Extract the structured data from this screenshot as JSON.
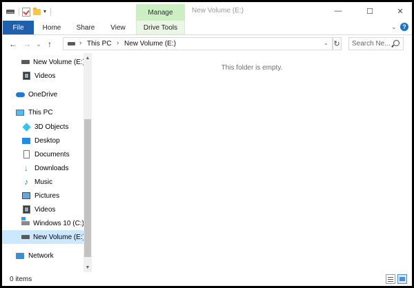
{
  "window": {
    "title": "New Volume (E:)",
    "context_tab_group": "Manage",
    "controls": {
      "minimize": "—",
      "maximize": "☐",
      "close": "✕"
    }
  },
  "qat": {
    "dropdown": "▾"
  },
  "ribbon": {
    "tabs": [
      "File",
      "Home",
      "Share",
      "View",
      "Drive Tools"
    ],
    "expand": "⌄",
    "help": "?"
  },
  "nav": {
    "back": "←",
    "forward": "→",
    "history": "⌄",
    "up": "↑",
    "crumb_sep": "›",
    "breadcrumb": [
      "This PC",
      "New Volume (E:)"
    ],
    "address_dropdown": "⌄",
    "refresh": "↻",
    "search_placeholder": "Search Ne..."
  },
  "navpane": {
    "items": [
      {
        "label": "New Volume (E:)",
        "icon": "drive-icon"
      },
      {
        "label": "Videos",
        "icon": "videos-icon"
      },
      {
        "label": "OneDrive",
        "icon": "onedrive-icon"
      },
      {
        "label": "This PC",
        "icon": "this-pc-icon"
      },
      {
        "label": "3D Objects",
        "icon": "3d-objects-icon"
      },
      {
        "label": "Desktop",
        "icon": "desktop-icon"
      },
      {
        "label": "Documents",
        "icon": "documents-icon"
      },
      {
        "label": "Downloads",
        "icon": "downloads-icon"
      },
      {
        "label": "Music",
        "icon": "music-icon"
      },
      {
        "label": "Pictures",
        "icon": "pictures-icon"
      },
      {
        "label": "Videos",
        "icon": "videos-icon"
      },
      {
        "label": "Windows 10 (C:)",
        "icon": "windows-drive-icon"
      },
      {
        "label": "New Volume (E:)",
        "icon": "drive-icon",
        "selected": true
      },
      {
        "label": "Network",
        "icon": "network-icon"
      }
    ],
    "scroll_up": "▲",
    "scroll_down": "▼"
  },
  "content": {
    "empty_message": "This folder is empty."
  },
  "status": {
    "item_count": "0 items"
  },
  "colors": {
    "file_tab": "#1f5fac",
    "manage_tab": "#cbeec2",
    "selection": "#cce8ff",
    "accent": "#1f78d1"
  }
}
